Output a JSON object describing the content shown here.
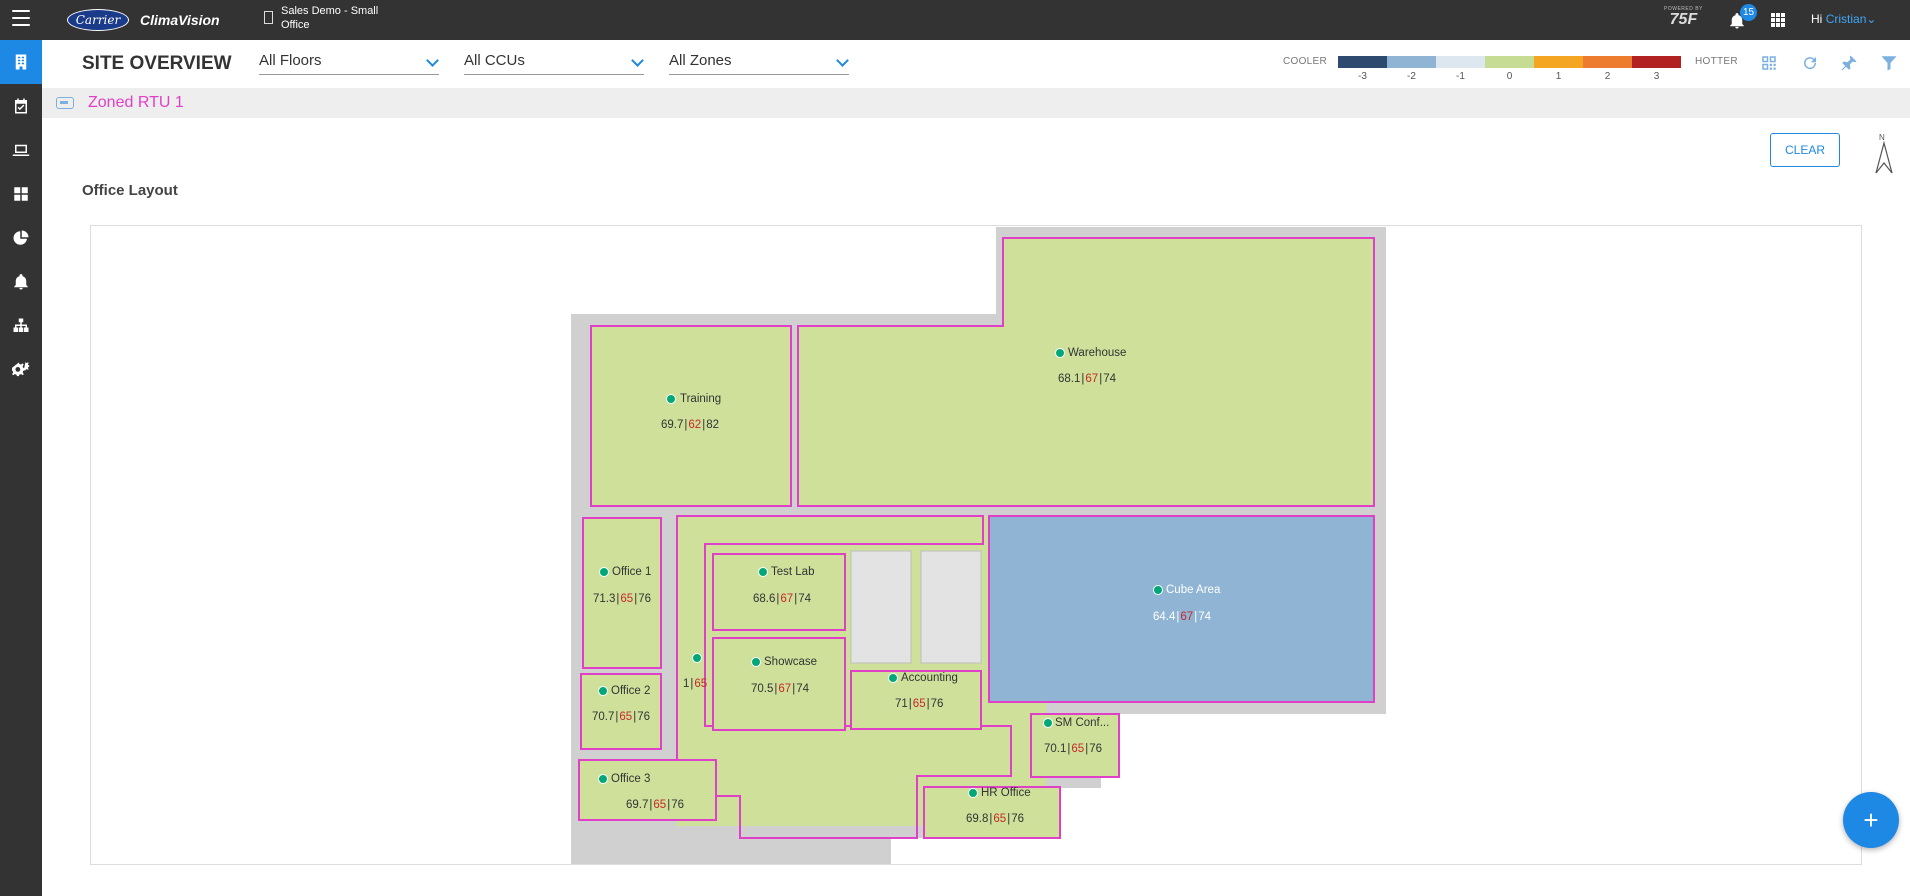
{
  "topbar": {
    "logo_text": "Carrier",
    "brand": "ClimaVision",
    "site_name": "Sales Demo - Small Office",
    "powered_by": "POWERED BY",
    "powered_brand": "75F",
    "notification_count": "15",
    "greeting": "Hi",
    "user_name": "Cristian"
  },
  "sidebar": {
    "items": [
      {
        "icon": "building-icon",
        "active": true
      },
      {
        "icon": "calendar-check-icon",
        "active": false
      },
      {
        "icon": "laptop-icon",
        "active": false
      },
      {
        "icon": "dashboard-grid-icon",
        "active": false
      },
      {
        "icon": "pie-chart-icon",
        "active": false
      },
      {
        "icon": "bell-icon",
        "active": false
      },
      {
        "icon": "hierarchy-icon",
        "active": false
      },
      {
        "icon": "settings-gears-icon",
        "active": false
      }
    ]
  },
  "header": {
    "title": "SITE OVERVIEW",
    "floor_select": "All Floors",
    "ccu_select": "All CCUs",
    "zone_select": "All Zones",
    "legend_cooler": "COOLER",
    "legend_hotter": "HOTTER",
    "scale_labels": [
      "-3",
      "-2",
      "-1",
      "0",
      "1",
      "2",
      "3"
    ],
    "scale_colors": [
      "#2e4a6e",
      "#8fb4d4",
      "#dde7f0",
      "#c6dc94",
      "#f4a623",
      "#ee7c2e",
      "#b22222"
    ]
  },
  "zonebar": {
    "zone_name": "Zoned RTU 1"
  },
  "content": {
    "clear_label": "CLEAR",
    "north_label": "N",
    "layout_title": "Office Layout"
  },
  "zones": [
    {
      "name": "Training",
      "current": "69.7",
      "setpoint": "62",
      "limit": "82"
    },
    {
      "name": "Warehouse",
      "current": "68.1",
      "setpoint": "67",
      "limit": "74"
    },
    {
      "name": "Office 1",
      "current": "71.3",
      "setpoint": "65",
      "limit": "76"
    },
    {
      "name": "Test Lab",
      "current": "68.6",
      "setpoint": "67",
      "limit": "74"
    },
    {
      "name": "Cube Area",
      "current": "64.4",
      "setpoint": "67",
      "limit": "74"
    },
    {
      "name": "Showcase",
      "current": "70.5",
      "setpoint": "67",
      "limit": "74"
    },
    {
      "name": "",
      "current": "1",
      "setpoint": "65",
      "limit": ""
    },
    {
      "name": "Accounting",
      "current": "71",
      "setpoint": "65",
      "limit": "76"
    },
    {
      "name": "Office 2",
      "current": "70.7",
      "setpoint": "65",
      "limit": "76"
    },
    {
      "name": "SM Conf...",
      "current": "70.1",
      "setpoint": "65",
      "limit": "76"
    },
    {
      "name": "Office 3",
      "current": "69.7",
      "setpoint": "65",
      "limit": "76"
    },
    {
      "name": "HR Office",
      "current": "69.8",
      "setpoint": "65",
      "limit": "76"
    }
  ],
  "fab_label": "+"
}
